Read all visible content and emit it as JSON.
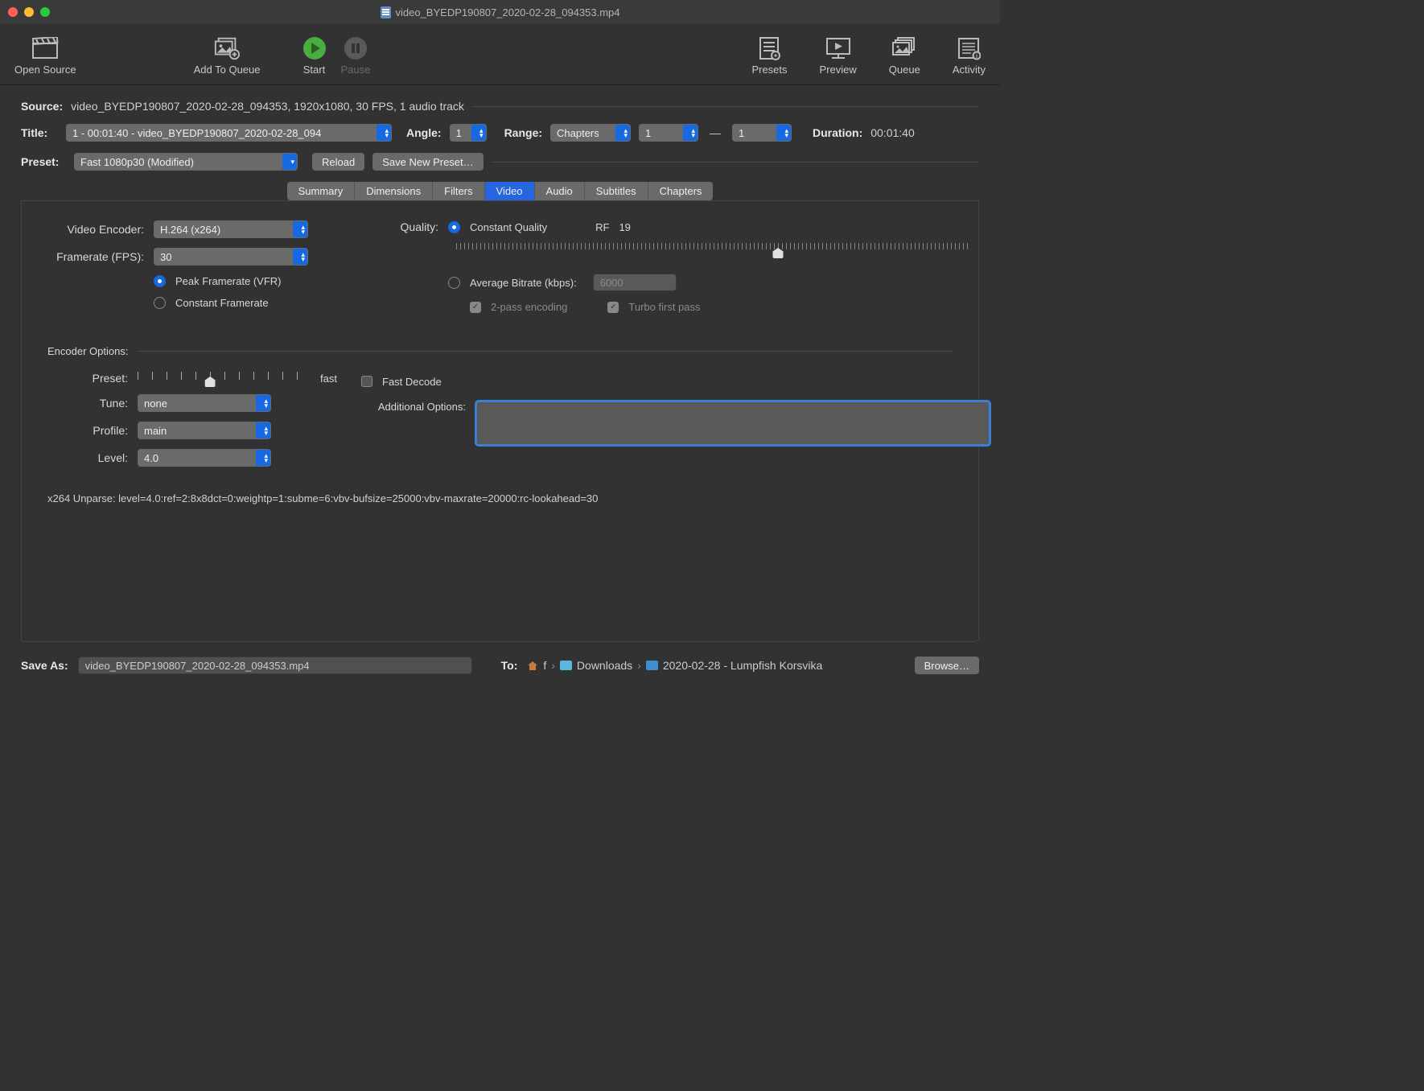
{
  "window": {
    "title": "video_BYEDP190807_2020-02-28_094353.mp4"
  },
  "toolbar": {
    "open_source": "Open Source",
    "add_to_queue": "Add To Queue",
    "start": "Start",
    "pause": "Pause",
    "presets": "Presets",
    "preview": "Preview",
    "queue": "Queue",
    "activity": "Activity"
  },
  "summary": {
    "source_label": "Source:",
    "source_text": "video_BYEDP190807_2020-02-28_094353, 1920x1080, 30 FPS, 1 audio track",
    "title_label": "Title:",
    "title_value": "1 - 00:01:40 - video_BYEDP190807_2020-02-28_094",
    "angle_label": "Angle:",
    "angle_value": "1",
    "range_label": "Range:",
    "range_type": "Chapters",
    "range_start": "1",
    "range_sep": "—",
    "range_end": "1",
    "duration_label": "Duration:",
    "duration_value": "00:01:40",
    "preset_label": "Preset:",
    "preset_value": "Fast 1080p30 (Modified)",
    "reload": "Reload",
    "save_new_preset": "Save New Preset…"
  },
  "tabs": [
    "Summary",
    "Dimensions",
    "Filters",
    "Video",
    "Audio",
    "Subtitles",
    "Chapters"
  ],
  "video": {
    "encoder_label": "Video Encoder:",
    "encoder_value": "H.264 (x264)",
    "fps_label": "Framerate (FPS):",
    "fps_value": "30",
    "peak_framerate": "Peak Framerate (VFR)",
    "constant_framerate": "Constant Framerate",
    "quality_label": "Quality:",
    "constant_quality": "Constant Quality",
    "rf_label": "RF",
    "rf_value": "19",
    "avg_bitrate": "Average Bitrate (kbps):",
    "avg_bitrate_value": "6000",
    "two_pass": "2-pass encoding",
    "turbo": "Turbo first pass"
  },
  "encoder": {
    "section_label": "Encoder Options:",
    "preset_label": "Preset:",
    "preset_value": "fast",
    "tune_label": "Tune:",
    "tune_value": "none",
    "fast_decode": "Fast Decode",
    "profile_label": "Profile:",
    "profile_value": "main",
    "addl_label": "Additional Options:",
    "level_label": "Level:",
    "level_value": "4.0",
    "unparse": "x264 Unparse: level=4.0:ref=2:8x8dct=0:weightp=1:subme=6:vbv-bufsize=25000:vbv-maxrate=20000:rc-lookahead=30"
  },
  "save": {
    "label": "Save As:",
    "filename": "video_BYEDP190807_2020-02-28_094353.mp4",
    "to_label": "To:",
    "path_user": "f",
    "path_downloads": "Downloads",
    "path_folder": "2020-02-28 - Lumpfish Korsvika",
    "browse": "Browse…"
  }
}
